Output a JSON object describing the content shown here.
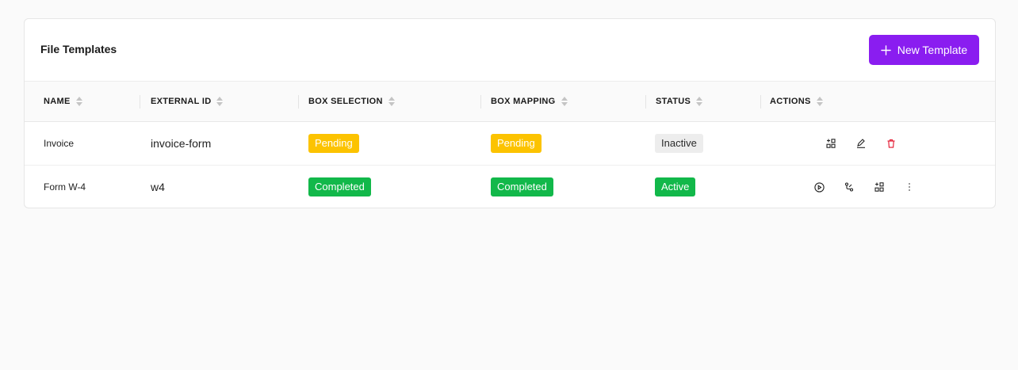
{
  "header": {
    "title": "File Templates",
    "new_button_label": "New Template"
  },
  "columns": [
    "NAME",
    "EXTERNAL ID",
    "BOX SELECTION",
    "BOX MAPPING",
    "STATUS",
    "ACTIONS"
  ],
  "rows": [
    {
      "name": "Invoice",
      "external_id": "invoice-form",
      "box_selection": "Pending",
      "box_mapping": "Pending",
      "status": "Inactive",
      "actions": [
        "box-select-icon",
        "edit-icon",
        "delete-icon"
      ]
    },
    {
      "name": "Form W-4",
      "external_id": "w4",
      "box_selection": "Completed",
      "box_mapping": "Completed",
      "status": "Active",
      "actions": [
        "play-icon",
        "mapping-icon",
        "box-select-icon",
        "more-vertical-icon"
      ]
    }
  ],
  "colors": {
    "accent": "#8a1df0",
    "pending": "#fcc300",
    "completed": "#12b84a",
    "inactive_bg": "#ededed",
    "delete": "#e5243b"
  }
}
